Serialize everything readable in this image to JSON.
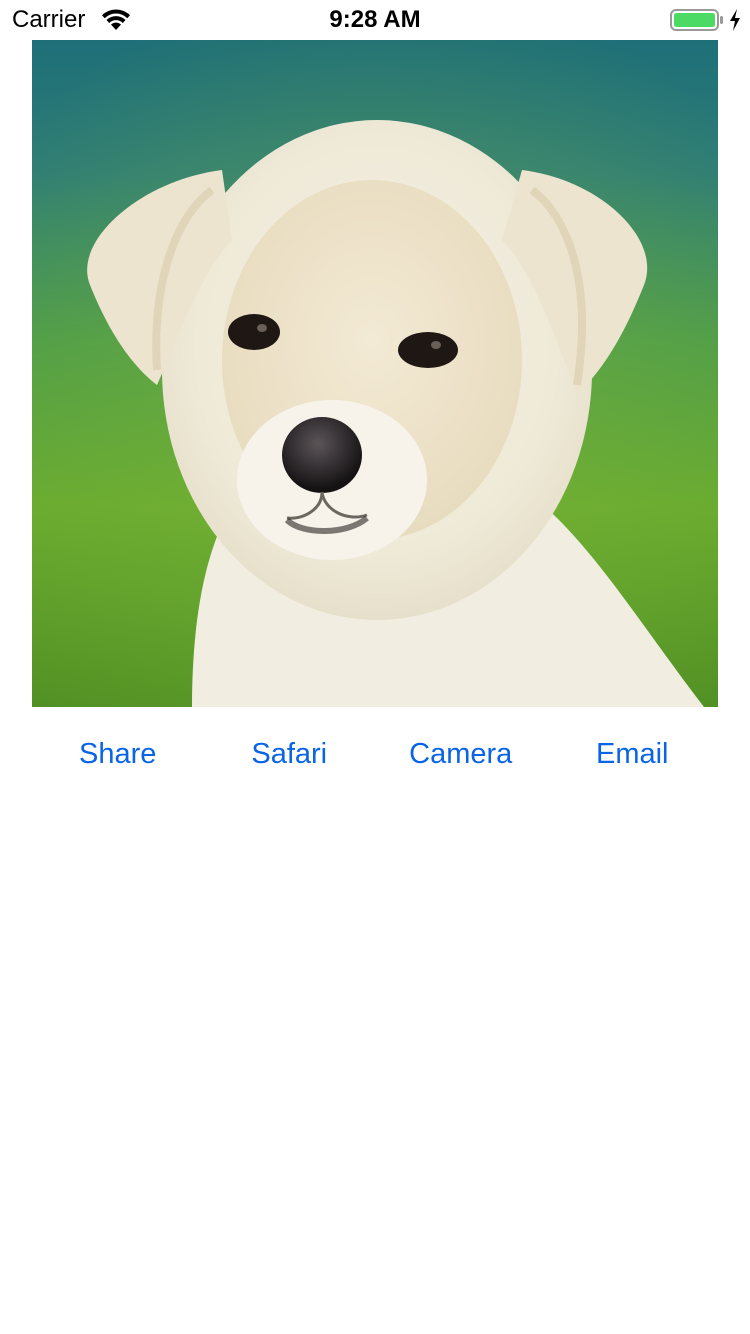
{
  "status_bar": {
    "carrier": "Carrier",
    "time": "9:28 AM",
    "wifi_icon": "wifi-icon",
    "battery_icon": "battery-charging-icon",
    "battery_level": 1.0,
    "battery_color": "#4cd964"
  },
  "photo": {
    "subject": "puppy-photo"
  },
  "actions": {
    "share_label": "Share",
    "safari_label": "Safari",
    "camera_label": "Camera",
    "email_label": "Email",
    "accent_color": "#0a64e6"
  }
}
